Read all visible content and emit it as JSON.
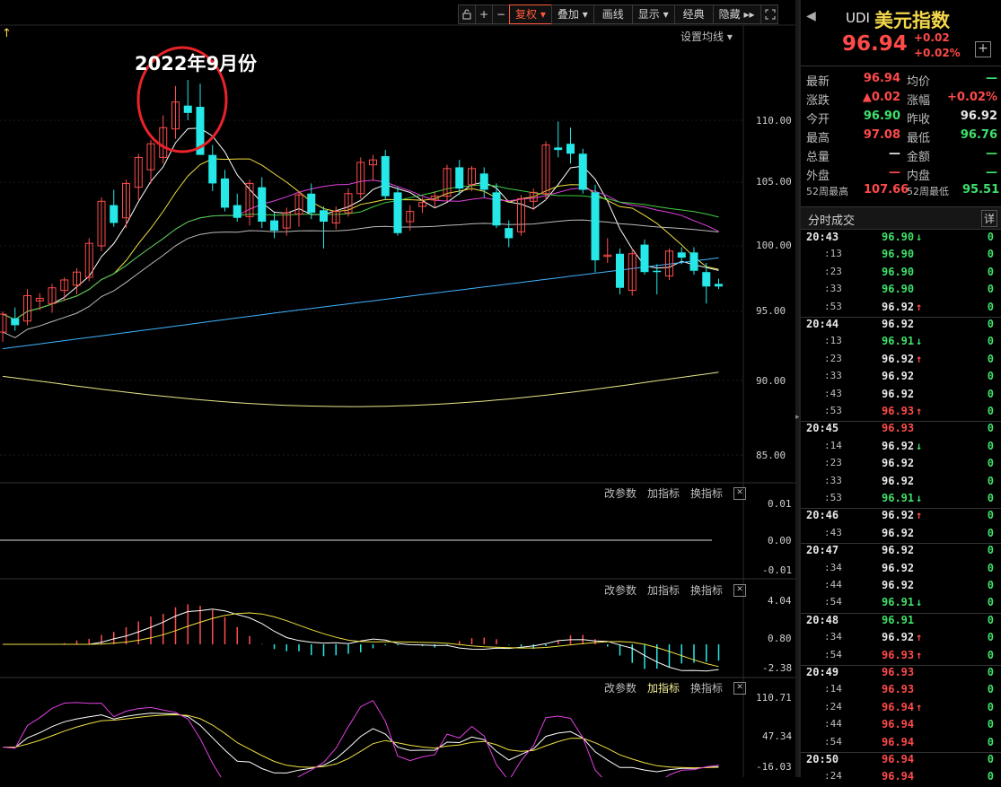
{
  "toolbar": {
    "lock_icon": "lock-icon",
    "plus_label": "+",
    "minus_label": "−",
    "fuquan": "复权",
    "diejia": "叠加",
    "huaxian": "画线",
    "xianshi": "显示",
    "jingdian": "经典",
    "yincang": "隐藏",
    "expand_icon": "expand-icon"
  },
  "main_chart": {
    "top_arrow": "↑",
    "settings_label": "设置均线",
    "annotation": "2022年9月份",
    "y_ticks": [
      "110.00",
      "105.00",
      "100.00",
      "95.00",
      "90.00",
      "85.00"
    ]
  },
  "panel1": {
    "tools": [
      "改参数",
      "加指标",
      "换指标"
    ],
    "y_ticks": [
      "0.01",
      "0.00",
      "-0.01"
    ]
  },
  "panel2": {
    "tools": [
      "改参数",
      "加指标",
      "换指标"
    ],
    "y_ticks": [
      "4.04",
      "0.80",
      "-2.38"
    ]
  },
  "panel3": {
    "tools": [
      "改参数",
      "加指标",
      "换指标"
    ],
    "y_ticks": [
      "110.71",
      "47.34",
      "-16.03"
    ]
  },
  "quote": {
    "code": "UDI",
    "name": "美元指数",
    "price": "96.94",
    "change": "+0.02",
    "change_pct": "+0.02%",
    "add_button": "+",
    "rows": [
      {
        "l1": "最新",
        "v1": "96.94",
        "c1": "red",
        "l2": "均价",
        "v2": "—",
        "c2": "green"
      },
      {
        "l1": "涨跌",
        "v1": "▲0.02",
        "c1": "red",
        "l2": "涨幅",
        "v2": "+0.02%",
        "c2": "red"
      },
      {
        "l1": "今开",
        "v1": "96.90",
        "c1": "green",
        "l2": "昨收",
        "v2": "96.92",
        "c2": "white"
      },
      {
        "l1": "最高",
        "v1": "97.08",
        "c1": "red",
        "l2": "最低",
        "v2": "96.76",
        "c2": "green"
      },
      {
        "l1": "总量",
        "v1": "—",
        "c1": "white",
        "l2": "金额",
        "v2": "—",
        "c2": "green"
      },
      {
        "l1": "外盘",
        "v1": "—",
        "c1": "red",
        "l2": "内盘",
        "v2": "—",
        "c2": "green"
      }
    ],
    "week52_high_label": "52周最高",
    "week52_high": "107.66",
    "week52_low_label": "52周最低",
    "week52_low": "95.51"
  },
  "ticks_header": {
    "title": "分时成交",
    "detail": "详"
  },
  "ticks": [
    {
      "time": "20:43",
      "sub": false,
      "price": "96.90",
      "color": "green",
      "arrow": "↓",
      "vol": "0"
    },
    {
      "time": ":13",
      "sub": true,
      "price": "96.90",
      "color": "green",
      "arrow": "",
      "vol": "0"
    },
    {
      "time": ":23",
      "sub": true,
      "price": "96.90",
      "color": "green",
      "arrow": "",
      "vol": "0"
    },
    {
      "time": ":33",
      "sub": true,
      "price": "96.90",
      "color": "green",
      "arrow": "",
      "vol": "0"
    },
    {
      "time": ":53",
      "sub": true,
      "price": "96.92",
      "color": "white",
      "arrow": "↑",
      "vol": "0"
    },
    {
      "time": "20:44",
      "sub": false,
      "price": "96.92",
      "color": "white",
      "arrow": "",
      "vol": "0"
    },
    {
      "time": ":13",
      "sub": true,
      "price": "96.91",
      "color": "green",
      "arrow": "↓",
      "vol": "0"
    },
    {
      "time": ":23",
      "sub": true,
      "price": "96.92",
      "color": "white",
      "arrow": "↑",
      "vol": "0"
    },
    {
      "time": ":33",
      "sub": true,
      "price": "96.92",
      "color": "white",
      "arrow": "",
      "vol": "0"
    },
    {
      "time": ":43",
      "sub": true,
      "price": "96.92",
      "color": "white",
      "arrow": "",
      "vol": "0"
    },
    {
      "time": ":53",
      "sub": true,
      "price": "96.93",
      "color": "red",
      "arrow": "↑",
      "vol": "0"
    },
    {
      "time": "20:45",
      "sub": false,
      "price": "96.93",
      "color": "red",
      "arrow": "",
      "vol": "0"
    },
    {
      "time": ":14",
      "sub": true,
      "price": "96.92",
      "color": "white",
      "arrow": "↓",
      "vol": "0"
    },
    {
      "time": ":23",
      "sub": true,
      "price": "96.92",
      "color": "white",
      "arrow": "",
      "vol": "0"
    },
    {
      "time": ":33",
      "sub": true,
      "price": "96.92",
      "color": "white",
      "arrow": "",
      "vol": "0"
    },
    {
      "time": ":53",
      "sub": true,
      "price": "96.91",
      "color": "green",
      "arrow": "↓",
      "vol": "0"
    },
    {
      "time": "20:46",
      "sub": false,
      "price": "96.92",
      "color": "white",
      "arrow": "↑",
      "vol": "0"
    },
    {
      "time": ":43",
      "sub": true,
      "price": "96.92",
      "color": "white",
      "arrow": "",
      "vol": "0"
    },
    {
      "time": "20:47",
      "sub": false,
      "price": "96.92",
      "color": "white",
      "arrow": "",
      "vol": "0"
    },
    {
      "time": ":34",
      "sub": true,
      "price": "96.92",
      "color": "white",
      "arrow": "",
      "vol": "0"
    },
    {
      "time": ":44",
      "sub": true,
      "price": "96.92",
      "color": "white",
      "arrow": "",
      "vol": "0"
    },
    {
      "time": ":54",
      "sub": true,
      "price": "96.91",
      "color": "green",
      "arrow": "↓",
      "vol": "0"
    },
    {
      "time": "20:48",
      "sub": false,
      "price": "96.91",
      "color": "green",
      "arrow": "",
      "vol": "0"
    },
    {
      "time": ":34",
      "sub": true,
      "price": "96.92",
      "color": "white",
      "arrow": "↑",
      "vol": "0"
    },
    {
      "time": ":54",
      "sub": true,
      "price": "96.93",
      "color": "red",
      "arrow": "↑",
      "vol": "0"
    },
    {
      "time": "20:49",
      "sub": false,
      "price": "96.93",
      "color": "red",
      "arrow": "",
      "vol": "0"
    },
    {
      "time": ":14",
      "sub": true,
      "price": "96.93",
      "color": "red",
      "arrow": "",
      "vol": "0"
    },
    {
      "time": ":24",
      "sub": true,
      "price": "96.94",
      "color": "red",
      "arrow": "↑",
      "vol": "0"
    },
    {
      "time": ":44",
      "sub": true,
      "price": "96.94",
      "color": "red",
      "arrow": "",
      "vol": "0"
    },
    {
      "time": ":54",
      "sub": true,
      "price": "96.94",
      "color": "red",
      "arrow": "",
      "vol": "0"
    },
    {
      "time": "20:50",
      "sub": false,
      "price": "96.94",
      "color": "red",
      "arrow": "",
      "vol": "0"
    },
    {
      "time": ":24",
      "sub": true,
      "price": "96.94",
      "color": "red",
      "arrow": "",
      "vol": "0"
    }
  ],
  "chart_data": {
    "type": "candlestick",
    "y_range": [
      85,
      112
    ],
    "candles": [
      {
        "o": 93.5,
        "h": 95.0,
        "l": 92.8,
        "c": 94.8
      },
      {
        "o": 94.5,
        "h": 95.3,
        "l": 93.6,
        "c": 94.0
      },
      {
        "o": 94.3,
        "h": 96.7,
        "l": 94.0,
        "c": 96.2
      },
      {
        "o": 95.8,
        "h": 96.4,
        "l": 95.1,
        "c": 96.0
      },
      {
        "o": 95.6,
        "h": 97.1,
        "l": 94.9,
        "c": 96.8
      },
      {
        "o": 96.6,
        "h": 97.6,
        "l": 95.8,
        "c": 97.4
      },
      {
        "o": 97.0,
        "h": 98.3,
        "l": 96.3,
        "c": 98.0
      },
      {
        "o": 97.6,
        "h": 100.6,
        "l": 97.3,
        "c": 100.2
      },
      {
        "o": 100.0,
        "h": 103.8,
        "l": 99.6,
        "c": 103.5
      },
      {
        "o": 103.2,
        "h": 104.4,
        "l": 101.5,
        "c": 101.8
      },
      {
        "o": 102.2,
        "h": 105.2,
        "l": 101.4,
        "c": 104.9
      },
      {
        "o": 104.6,
        "h": 107.3,
        "l": 103.6,
        "c": 107.0
      },
      {
        "o": 106.0,
        "h": 108.4,
        "l": 104.9,
        "c": 108.1
      },
      {
        "o": 107.0,
        "h": 110.4,
        "l": 106.5,
        "c": 109.4
      },
      {
        "o": 109.3,
        "h": 112.8,
        "l": 108.5,
        "c": 111.5
      },
      {
        "o": 111.2,
        "h": 113.3,
        "l": 110.0,
        "c": 110.6
      },
      {
        "o": 111.1,
        "h": 113.0,
        "l": 109.6,
        "c": 107.2
      },
      {
        "o": 107.2,
        "h": 108.0,
        "l": 104.3,
        "c": 104.9
      },
      {
        "o": 105.3,
        "h": 106.0,
        "l": 102.7,
        "c": 103.0
      },
      {
        "o": 103.2,
        "h": 104.1,
        "l": 101.9,
        "c": 102.2
      },
      {
        "o": 102.3,
        "h": 105.2,
        "l": 101.6,
        "c": 104.9
      },
      {
        "o": 104.6,
        "h": 105.4,
        "l": 101.4,
        "c": 101.9
      },
      {
        "o": 102.0,
        "h": 102.6,
        "l": 100.6,
        "c": 101.2
      },
      {
        "o": 101.4,
        "h": 103.0,
        "l": 100.8,
        "c": 102.6
      },
      {
        "o": 102.5,
        "h": 104.3,
        "l": 101.5,
        "c": 104.0
      },
      {
        "o": 104.1,
        "h": 104.9,
        "l": 102.1,
        "c": 102.6
      },
      {
        "o": 102.8,
        "h": 103.1,
        "l": 99.8,
        "c": 101.9
      },
      {
        "o": 101.8,
        "h": 103.1,
        "l": 101.3,
        "c": 102.7
      },
      {
        "o": 102.6,
        "h": 104.5,
        "l": 102.3,
        "c": 104.1
      },
      {
        "o": 104.1,
        "h": 107.0,
        "l": 103.7,
        "c": 106.6
      },
      {
        "o": 106.4,
        "h": 107.2,
        "l": 105.1,
        "c": 106.8
      },
      {
        "o": 107.1,
        "h": 107.6,
        "l": 103.6,
        "c": 103.9
      },
      {
        "o": 104.2,
        "h": 104.6,
        "l": 100.8,
        "c": 101.0
      },
      {
        "o": 101.9,
        "h": 103.2,
        "l": 101.2,
        "c": 102.7
      },
      {
        "o": 103.1,
        "h": 103.8,
        "l": 102.6,
        "c": 103.4
      },
      {
        "o": 103.6,
        "h": 104.3,
        "l": 103.0,
        "c": 103.9
      },
      {
        "o": 103.9,
        "h": 106.4,
        "l": 103.5,
        "c": 106.1
      },
      {
        "o": 106.2,
        "h": 106.8,
        "l": 104.0,
        "c": 104.5
      },
      {
        "o": 104.8,
        "h": 106.3,
        "l": 104.3,
        "c": 106.1
      },
      {
        "o": 105.7,
        "h": 106.2,
        "l": 103.8,
        "c": 104.4
      },
      {
        "o": 104.2,
        "h": 104.9,
        "l": 101.4,
        "c": 101.6
      },
      {
        "o": 101.4,
        "h": 102.0,
        "l": 99.9,
        "c": 100.6
      },
      {
        "o": 101.1,
        "h": 104.0,
        "l": 100.8,
        "c": 103.7
      },
      {
        "o": 103.5,
        "h": 104.5,
        "l": 102.8,
        "c": 104.2
      },
      {
        "o": 104.1,
        "h": 108.3,
        "l": 103.6,
        "c": 108.0
      },
      {
        "o": 107.8,
        "h": 109.9,
        "l": 107.0,
        "c": 107.6
      },
      {
        "o": 108.1,
        "h": 109.4,
        "l": 106.5,
        "c": 107.3
      },
      {
        "o": 107.3,
        "h": 107.7,
        "l": 104.1,
        "c": 104.4
      },
      {
        "o": 104.2,
        "h": 104.8,
        "l": 98.0,
        "c": 98.9
      },
      {
        "o": 99.2,
        "h": 100.6,
        "l": 98.7,
        "c": 99.3
      },
      {
        "o": 99.4,
        "h": 99.8,
        "l": 96.3,
        "c": 96.8
      },
      {
        "o": 96.6,
        "h": 99.8,
        "l": 96.2,
        "c": 99.4
      },
      {
        "o": 100.1,
        "h": 100.5,
        "l": 97.8,
        "c": 98.0
      },
      {
        "o": 98.1,
        "h": 98.6,
        "l": 96.3,
        "c": 98.0
      },
      {
        "o": 97.7,
        "h": 99.8,
        "l": 97.4,
        "c": 99.6
      },
      {
        "o": 99.5,
        "h": 99.9,
        "l": 98.6,
        "c": 99.1
      },
      {
        "o": 99.5,
        "h": 99.9,
        "l": 97.8,
        "c": 98.1
      },
      {
        "o": 98.0,
        "h": 98.7,
        "l": 95.6,
        "c": 96.9
      },
      {
        "o": 97.1,
        "h": 97.5,
        "l": 96.7,
        "c": 96.9
      }
    ]
  }
}
